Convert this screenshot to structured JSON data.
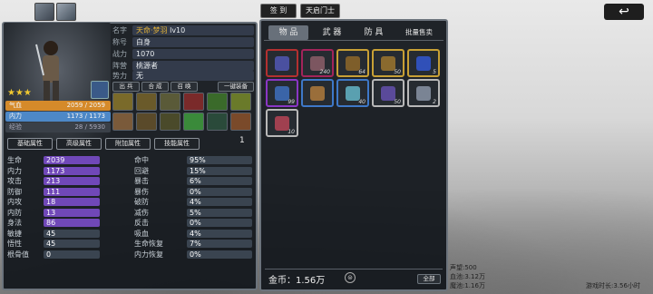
{
  "top_tabs": {
    "rank": "签 到",
    "level_tab": "天启门士"
  },
  "character": {
    "name_label": "名字",
    "name": "天命·梦羽",
    "level": "lv10",
    "title_label": "称号",
    "title": "白身",
    "power_label": "战力",
    "power": "1070",
    "camp_label": "阵营",
    "camp": "桃源者",
    "faction_label": "势力",
    "faction": "无",
    "stars": "★★★",
    "hp_bar": {
      "value": "2059 / 2059",
      "fill": 1.0,
      "color": "#d58a2a"
    },
    "mp_bar": {
      "value": "1173 / 1173",
      "fill": 1.0,
      "color": "#4d88c7"
    },
    "exp_bar": {
      "value": "28 / 5930",
      "fill": 0.005
    },
    "hp_label": "气血",
    "mp_label": "内力",
    "exp_label": "经验"
  },
  "equip_buttons": {
    "b1": "出 兵",
    "b2": "合 成",
    "b3": "召 唤",
    "b4": "一键装备"
  },
  "tab_number": "1",
  "attr_buttons": [
    "基础属性",
    "高级属性",
    "附加属性",
    "技能属性"
  ],
  "stats_left": [
    {
      "label": "生命",
      "value": "2039"
    },
    {
      "label": "内力",
      "value": "1173"
    },
    {
      "label": "攻击",
      "value": "213"
    },
    {
      "label": "防御",
      "value": "111"
    },
    {
      "label": "内攻",
      "value": "18"
    },
    {
      "label": "内防",
      "value": "13"
    },
    {
      "label": "身法",
      "value": "86"
    },
    {
      "label": "敏捷",
      "value": "45"
    },
    {
      "label": "悟性",
      "value": "45"
    },
    {
      "label": "根骨值",
      "value": "0"
    }
  ],
  "stats_right": [
    {
      "label": "命中",
      "value": "95%"
    },
    {
      "label": "回避",
      "value": "15%"
    },
    {
      "label": "暴击",
      "value": "6%"
    },
    {
      "label": "暴伤",
      "value": "0%"
    },
    {
      "label": "破防",
      "value": "4%"
    },
    {
      "label": "减伤",
      "value": "5%"
    },
    {
      "label": "反击",
      "value": "0%"
    },
    {
      "label": "吸血",
      "value": "4%"
    },
    {
      "label": "生命恢复",
      "value": "7%"
    },
    {
      "label": "内力恢复",
      "value": "0%"
    }
  ],
  "inventory": {
    "tabs": [
      "物 品",
      "武 器",
      "防 具",
      "批量售卖"
    ],
    "items": [
      {
        "border": "#b33030",
        "icon": "#4a50a0",
        "qty": ""
      },
      {
        "border": "#a3245a",
        "icon": "#7c5660",
        "qty": "240"
      },
      {
        "border": "#c8a035",
        "icon": "#7e5e2a",
        "qty": "64"
      },
      {
        "border": "#c8a035",
        "icon": "#8a6a2e",
        "qty": "50"
      },
      {
        "border": "#c8a035",
        "icon": "#3050b8",
        "qty": "5"
      },
      {
        "border": "#8a36c5",
        "icon": "#3a64a8",
        "qty": "99"
      },
      {
        "border": "#3e78c8",
        "icon": "#9a6e3a",
        "qty": ""
      },
      {
        "border": "#3e78c8",
        "icon": "#5aa0b0",
        "qty": "40"
      },
      {
        "border": "#b8b8b8",
        "icon": "#5a4a9a",
        "qty": "50"
      },
      {
        "border": "#b8b8b8",
        "icon": "#7a8494",
        "qty": "2"
      },
      {
        "border": "#b8b8b8",
        "icon": "#a04050",
        "qty": "10"
      }
    ],
    "gold_label": "金币：",
    "gold_value": "1.56万",
    "all_button": "全部"
  },
  "right_info": {
    "reputation": "声望:500",
    "blood_pool": "血池:3.12万",
    "mana_pool": "魔池:1.16万",
    "play_time": "游戏时长:3.56小时"
  }
}
